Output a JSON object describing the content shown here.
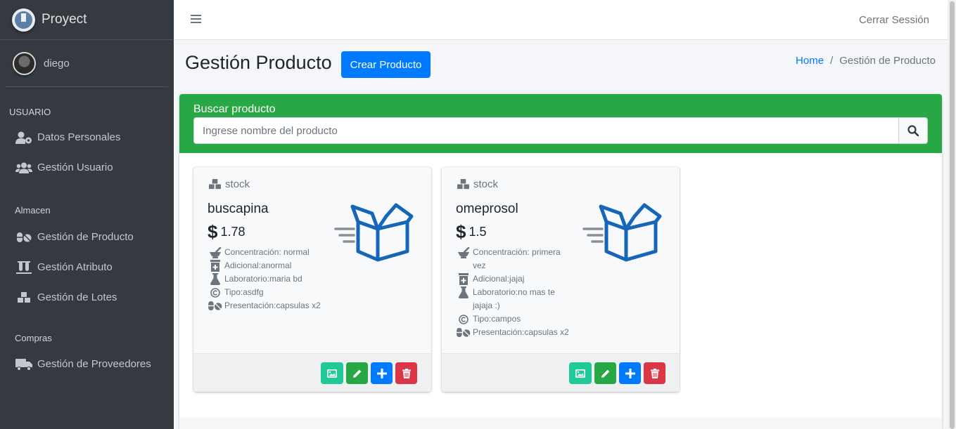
{
  "brand": {
    "name": "Proyect"
  },
  "user": {
    "name": "diego"
  },
  "sidebar": {
    "sections": [
      {
        "header": "USUARIO",
        "items": [
          {
            "label": "Datos Personales",
            "icon": "user-cog-icon"
          },
          {
            "label": "Gestión Usuario",
            "icon": "users-icon"
          }
        ]
      },
      {
        "header": "Almacen",
        "items": [
          {
            "label": "Gestión de Producto",
            "icon": "pills-icon"
          },
          {
            "label": "Gestión Atributo",
            "icon": "vials-icon"
          },
          {
            "label": "Gestión de Lotes",
            "icon": "cubes-icon"
          }
        ]
      },
      {
        "header": "Compras",
        "items": [
          {
            "label": "Gestión de Proveedores",
            "icon": "truck-icon"
          }
        ]
      }
    ]
  },
  "topbar": {
    "logout": "Cerrar Sessión"
  },
  "header": {
    "title": "Gestión Producto",
    "create_button": "Crear Producto",
    "breadcrumb": {
      "home": "Home",
      "separator": "/",
      "current": "Gestión de Producto"
    }
  },
  "search": {
    "title": "Buscar producto",
    "placeholder": "Ingrese nombre del producto",
    "value": ""
  },
  "products": [
    {
      "stock_label": "stock",
      "name": "buscapina",
      "price": "1.78",
      "concentracion": "Concentración: normal",
      "adicional": "Adicional:anormal",
      "laboratorio": "Laboratorio:maria bd",
      "tipo": "Tipo:asdfg",
      "presentacion": "Presentación:capsulas x2"
    },
    {
      "stock_label": "stock",
      "name": "omeprosol",
      "price": "1.5",
      "concentracion": "Concentración: primera vez",
      "adicional": "Adicional:jajaj",
      "laboratorio": "Laboratorio:no mas te jajaja :)",
      "tipo": "Tipo:campos",
      "presentacion": "Presentación:capsulas x2"
    }
  ],
  "colors": {
    "sidebar_bg": "#343a40",
    "primary": "#007bff",
    "success": "#28a745",
    "teal": "#20c997",
    "danger": "#dc3545",
    "box_icon": "#1565b8"
  }
}
